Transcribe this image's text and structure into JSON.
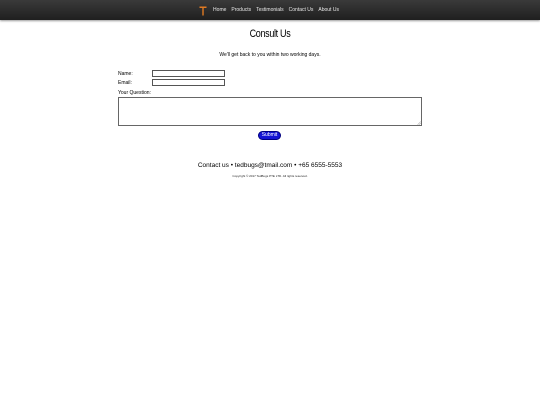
{
  "nav": {
    "items": [
      {
        "label": "Home"
      },
      {
        "label": "Products"
      },
      {
        "label": "Testimonials"
      },
      {
        "label": "Contact Us"
      },
      {
        "label": "About Us"
      }
    ],
    "logo_color": "#e07a22"
  },
  "page": {
    "title": "Consult Us",
    "subtitle": "We'll get back to you within two working days."
  },
  "form": {
    "name_label": "Name:",
    "name_value": "",
    "email_label": "Email:",
    "email_value": "",
    "question_label": "Your Question:",
    "question_value": "",
    "submit_label": "Submit"
  },
  "footer": {
    "contact": "Contact us • tedbugs@tmail.com • +65 6555-5553",
    "copyright": "Copyright © 2017 TedBugs PTE LTD. All rights reserved."
  },
  "colors": {
    "navbar": "#2b2b2b",
    "submit_bg": "#1414d4"
  }
}
